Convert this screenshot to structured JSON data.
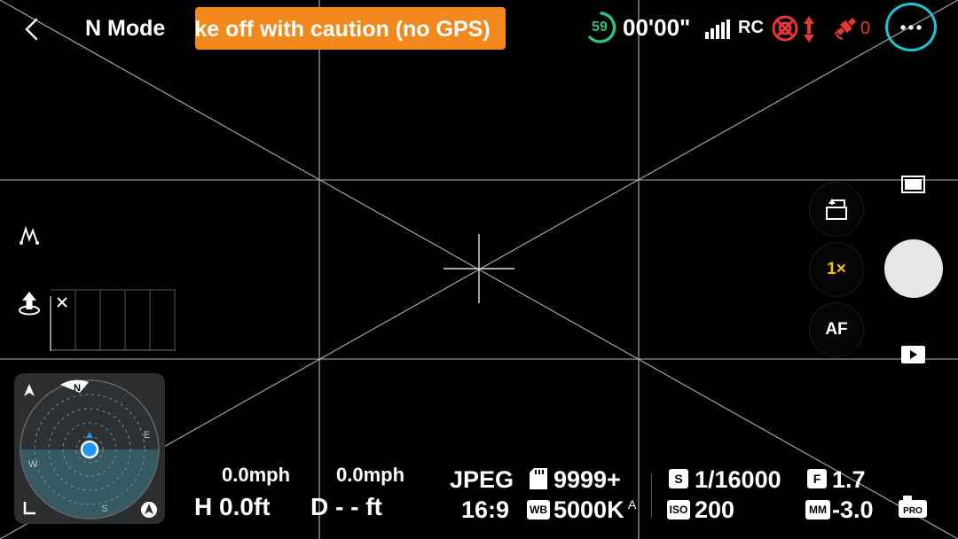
{
  "header": {
    "mode_title": "N Mode",
    "warning_text": "Take off with caution (no GPS)",
    "battery_percent": "59",
    "flight_time": "00'00\"",
    "rc_label": "RC",
    "gps_satellites": "0",
    "colors": {
      "warning_bg": "#f2891c",
      "battery": "#2ec27e",
      "alert": "#e53935",
      "highlight": "#18c6d8"
    }
  },
  "controls": {
    "zoom_label": "1×",
    "af_label": "AF"
  },
  "compass": {
    "north": "N",
    "east": "E",
    "south": "S",
    "west": "W"
  },
  "telemetry": {
    "horizontal_speed": "0.0mph",
    "vertical_speed": "0.0mph",
    "height": "H 0.0ft",
    "distance": "D - - ft"
  },
  "camera": {
    "format": "JPEG",
    "aspect_ratio": "16:9",
    "storage_remaining": "9999+",
    "wb_badge": "WB",
    "white_balance": "5000K",
    "wb_mode": "A",
    "shutter_badge": "S",
    "shutter_speed": "1/16000",
    "iso_badge": "ISO",
    "iso": "200",
    "aperture_badge": "F",
    "aperture": "1.7",
    "ev_badge": "MM",
    "exposure_comp": "-3.0",
    "pro_label": "PRO"
  },
  "icons": {
    "back": "chevron-left-icon",
    "signal": "signal-bars-icon",
    "obstacle": "obstacle-sensing-icon",
    "gps": "gps-satellite-icon",
    "more": "more-dots-icon",
    "route": "route-icon",
    "takeoff": "takeoff-icon",
    "camera_switch": "camera-switch-icon",
    "display_mode": "display-mode-icon",
    "playback": "play-icon",
    "sd_card": "sd-card-icon",
    "pro": "pro-mode-icon"
  }
}
